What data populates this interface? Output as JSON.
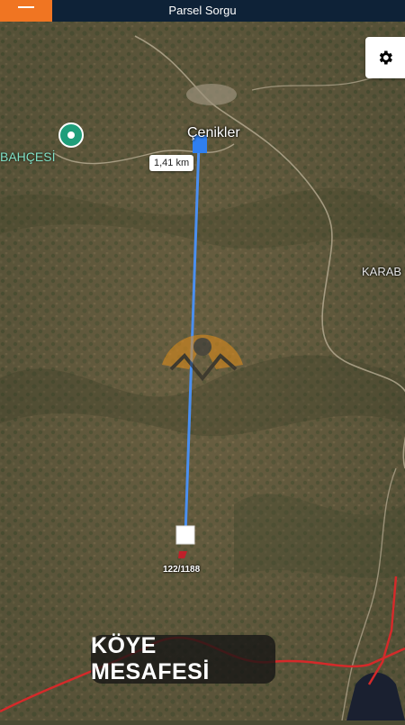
{
  "app": {
    "title": "Parsel Sorgu"
  },
  "toolbar": {
    "menu_icon": "hamburger-icon",
    "settings_icon": "gear-icon"
  },
  "map": {
    "places": {
      "village": "Çenikler",
      "poi": "BAHÇESİ",
      "east": "KARAB"
    },
    "measure": {
      "distance_label": "1,41 km"
    },
    "parcel": {
      "label": "122/1188"
    },
    "caption": "KÖYE MESAFESİ"
  },
  "colors": {
    "topbar": "#0e2237",
    "menu_button": "#f07522",
    "measure_line": "#4a8ff0",
    "boundary_line": "#d42a2a"
  }
}
